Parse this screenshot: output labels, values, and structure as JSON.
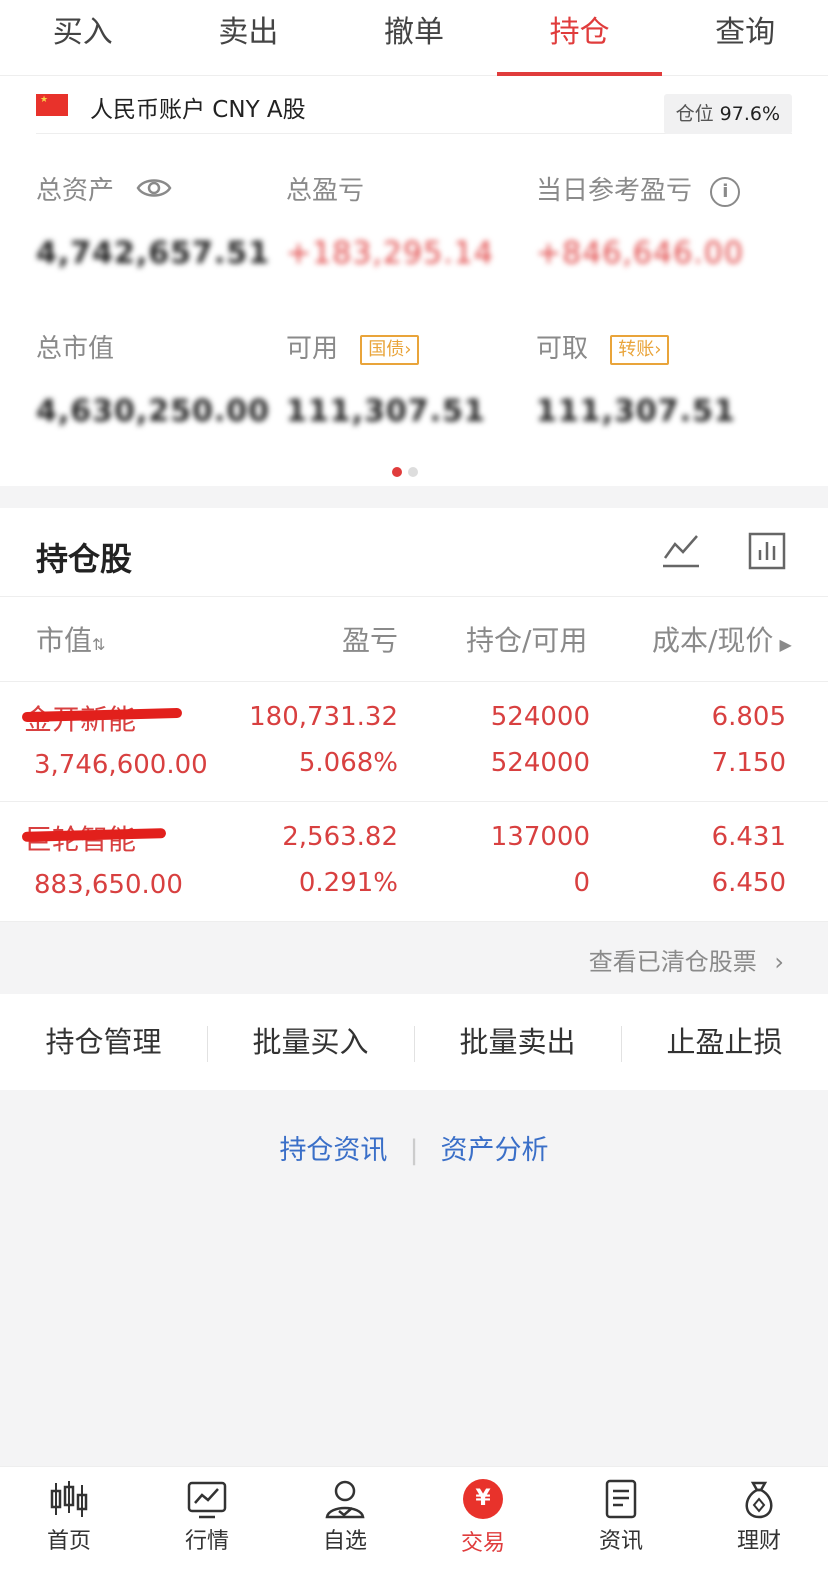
{
  "tabs": [
    "买入",
    "卖出",
    "撤单",
    "持仓",
    "查询"
  ],
  "account": {
    "name": "人民币账户 CNY A股",
    "position_label": "仓位",
    "position_value": "97.6%"
  },
  "stats": {
    "total_assets_label": "总资产",
    "total_assets_value": "4,742,657.51",
    "total_pnl_label": "总盈亏",
    "total_pnl_value": "+183,295.14",
    "daily_pnl_label": "当日参考盈亏",
    "daily_pnl_value": "+846,646.00",
    "market_value_label": "总市值",
    "market_value_value": "4,630,250.00",
    "available_label": "可用",
    "available_tag": "国债",
    "available_value": "111,307.51",
    "withdrawable_label": "可取",
    "withdrawable_tag": "转账",
    "withdrawable_value": "111,307.51"
  },
  "holdings": {
    "title": "持仓股",
    "headers": {
      "market_value": "市值",
      "pnl": "盈亏",
      "position": "持仓/可用",
      "cost": "成本/现价"
    },
    "rows": [
      {
        "name": "金开新能",
        "market_value": "3,746,600.00",
        "pnl": "180,731.32",
        "pnl_pct": "5.068%",
        "position": "524000",
        "available": "524000",
        "cost": "6.805",
        "price": "7.150"
      },
      {
        "name": "巨轮智能",
        "market_value": "883,650.00",
        "pnl": "2,563.82",
        "pnl_pct": "0.291%",
        "position": "137000",
        "available": "0",
        "cost": "6.431",
        "price": "6.450"
      }
    ],
    "cleared_link": "查看已清仓股票"
  },
  "actions": [
    "持仓管理",
    "批量买入",
    "批量卖出",
    "止盈止损"
  ],
  "links": [
    "持仓资讯",
    "资产分析"
  ],
  "nav": [
    {
      "label": "首页",
      "icon": "candlestick-icon"
    },
    {
      "label": "行情",
      "icon": "chart-monitor-icon"
    },
    {
      "label": "自选",
      "icon": "user-check-icon"
    },
    {
      "label": "交易",
      "icon": "yuan-icon"
    },
    {
      "label": "资讯",
      "icon": "document-icon"
    },
    {
      "label": "理财",
      "icon": "money-bag-icon"
    }
  ],
  "colors": {
    "accent": "#e03c3c",
    "link": "#3a6fc8",
    "tag": "#e9a43a"
  }
}
